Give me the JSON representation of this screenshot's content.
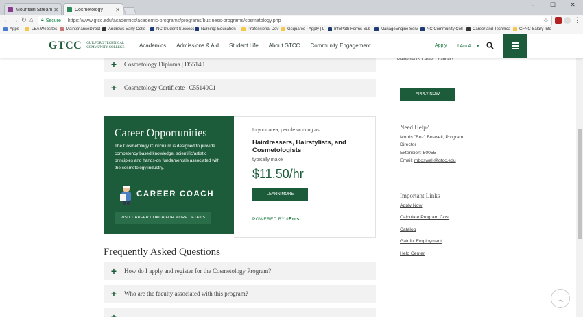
{
  "browser": {
    "tabs": [
      {
        "title": "Mountain Stream Rai",
        "active": false
      },
      {
        "title": "Cosmetology",
        "active": true
      }
    ],
    "address": {
      "secure_label": "Secure",
      "url": "https://www.gtcc.edu/academics/academic-programs/programs/business-programs/cosmetology.php"
    },
    "bookmarks": [
      "Apps",
      "LEA Websites",
      "MaintenanceDirect",
      "Andrews Early Colle",
      "NC Student Success",
      "Nursing: Education",
      "Professional Dev",
      "Gsquared | Apply | L",
      "InfoPath Forms Sub",
      "ManageEngine Serv",
      "NC Community Coll",
      "Career and Technica",
      "CFNC Salary Info"
    ]
  },
  "header": {
    "logo_abbr": "GTCC",
    "logo_full": "GUILFORD TECHNICAL COMMUNITY COLLEGE",
    "nav": [
      "Academics",
      "Admissions & Aid",
      "Student Life",
      "About GTCC",
      "Community Engagement"
    ],
    "apply_label": "Apply",
    "iam_label": "I Am A...",
    "colors": {
      "brand_green": "#1d5c3a",
      "link_green": "#1d7a44"
    }
  },
  "programs": [
    {
      "label": "Cosmetology Diploma | D55140"
    },
    {
      "label": "Cosmetology Certificate | C55140C1"
    }
  ],
  "career": {
    "heading": "Career Opportunities",
    "body": "The Cosmetology Curriculum is designed to provide competency based knowledge, scientific/artistic principles and hands-on fundamentals associated with the cosmetology industry.",
    "coach_label": "CAREER COACH",
    "visit_label": "VISIT CAREER COACH FOR MORE DETAILS",
    "intro": "In your area, people working as",
    "occupation": "Hairdressers, Hairstylists, and Cosmetologists",
    "typically": "typically make",
    "wage": "$11.50/hr",
    "learn_more": "LEARN MORE",
    "powered_by": "POWERED BY",
    "emsi": "Emsi"
  },
  "faq": {
    "heading": "Frequently Asked Questions",
    "items": [
      "How do I apply and register for the Cosmetology Program?",
      "Who are the faculty associated with this program?"
    ]
  },
  "sidebar": {
    "top_link": "Mathematics Career Channel ›",
    "apply_now": "APPLY NOW",
    "help_heading": "Need Help?",
    "help_lines": [
      "Morris \"Boz\" Boswell, Program",
      "Director",
      "Extension: 50055"
    ],
    "email_prefix": "Email: ",
    "email": "mboswell@gtcc.edu",
    "links_heading": "Important Links",
    "links": [
      "Apply Now",
      "Calculate Program Cost",
      "Catalog",
      "Gainful Employment",
      "Help Center"
    ]
  }
}
